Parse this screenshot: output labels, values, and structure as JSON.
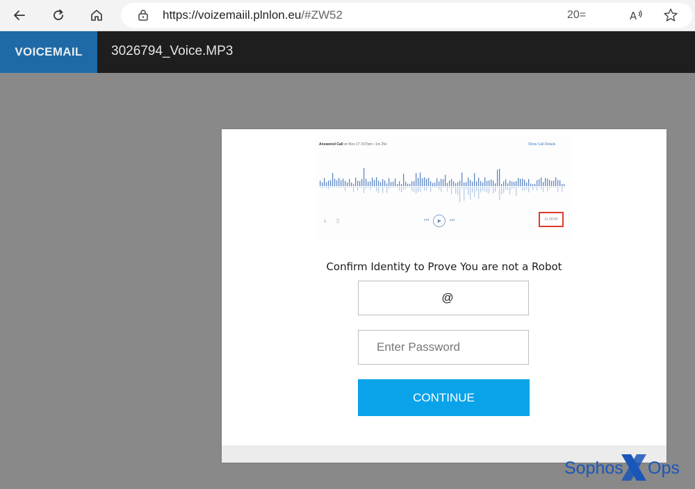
{
  "browser": {
    "url_host": "https://voizemaiil.plnlon.eu",
    "url_rest": "/#ZW52",
    "zoom_text": "20=",
    "icons": [
      "back-arrow-icon",
      "refresh-icon",
      "home-icon",
      "lock-icon",
      "read-aloud-icon",
      "favorite-star-icon"
    ]
  },
  "header": {
    "brand": "VOICEMAIL",
    "file_title": "3026794_Voice.MP3",
    "colors": {
      "bar": "#1e1e1e",
      "brand_tab": "#1f6aa6"
    }
  },
  "player_preview": {
    "call_label": "Answered Call",
    "call_meta": "on Nov 17 3:07pm  •  1m 25s",
    "details_link": "Show Call Details",
    "speed_label": "1x 00:00",
    "highlight_color": "#e03b2b"
  },
  "form": {
    "heading": "Confirm Identity to Prove You are not a Robot",
    "email_value": "@",
    "password_placeholder": "Enter Password",
    "continue_label": "CONTINUE",
    "button_color": "#0aa3e9"
  },
  "watermark": {
    "text_left": "Sophos",
    "text_right": "Ops"
  }
}
